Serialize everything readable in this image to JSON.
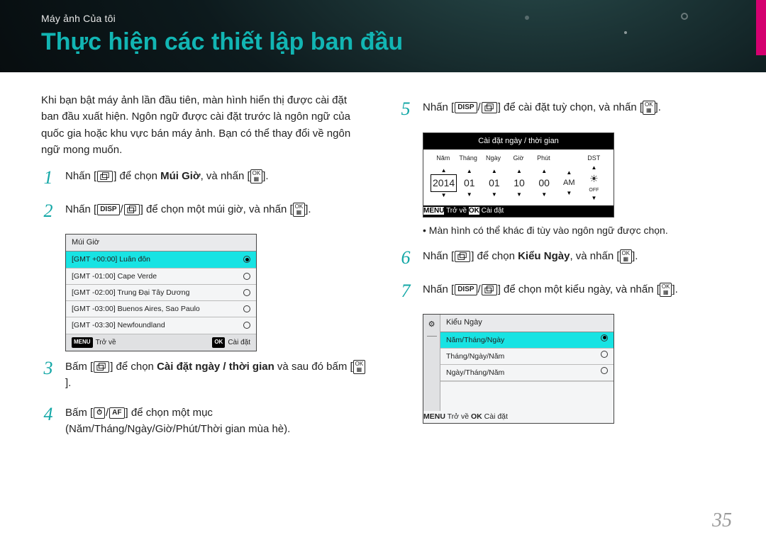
{
  "breadcrumb": "Máy ảnh Của tôi",
  "title": "Thực hiện các thiết lập ban đầu",
  "intro": "Khi bạn bật máy ảnh lần đầu tiên, màn hình hiển thị được cài đặt ban đầu xuất hiện. Ngôn ngữ được cài đặt trước là ngôn ngữ của quốc gia hoặc khu vực bán máy ảnh. Bạn có thể thay đổi về ngôn ngữ mong muốn.",
  "steps": {
    "s1_a": "Nhấn [",
    "s1_b": "] để chọn ",
    "s1_bold": "Múi Giờ",
    "s1_c": ", và nhấn [",
    "s1_d": "].",
    "s2_a": "Nhấn [",
    "s2_b": "] để chọn một múi giờ, và nhấn [",
    "s2_c": "].",
    "s3_a": "Bấm [",
    "s3_b": "] để chọn ",
    "s3_bold": "Cài đặt ngày / thời gian",
    "s3_c": " và sau đó bấm [",
    "s3_d": "].",
    "s4_a": "Bấm [",
    "s4_b": "] để chọn một mục (Năm/Tháng/Ngày/Giờ/Phút/Thời gian mùa hè).",
    "s5_a": "Nhấn [",
    "s5_b": "] để cài đặt tuỳ chọn, và nhấn [",
    "s5_c": "].",
    "s6_a": "Nhấn [",
    "s6_b": "] để chọn ",
    "s6_bold": "Kiểu Ngày",
    "s6_c": ", và nhấn [",
    "s6_d": "].",
    "s7_a": "Nhấn [",
    "s7_b": "] để chọn một kiểu ngày, và nhấn [",
    "s7_c": "]."
  },
  "key_disp": "DISP",
  "key_ok": "OK",
  "key_menu": "MENU",
  "key_af": "AF",
  "tz_panel": {
    "title": "Múi Giờ",
    "rows": [
      "[GMT +00:00] Luân đôn",
      "[GMT -01:00] Cape Verde",
      "[GMT -02:00] Trung Đại Tây Dương",
      "[GMT -03:00] Buenos Aires, Sao Paulo",
      "[GMT -03:30] Newfoundland"
    ],
    "back": "Trở về",
    "set": "Cài đặt"
  },
  "dt_panel": {
    "title": "Cài đặt ngày / thời gian",
    "labels": [
      "Năm",
      "Tháng",
      "Ngày",
      "Giờ",
      "Phút",
      "",
      "DST"
    ],
    "year": "2014",
    "month": "01",
    "day": "01",
    "hour": "10",
    "minute": "00",
    "ampm": "AM",
    "dst_off": "OFF",
    "back": "Trở về",
    "set": "Cài đặt"
  },
  "note": "Màn hình có thể khác đi tùy vào ngôn ngữ được chọn.",
  "type_panel": {
    "title": "Kiểu Ngày",
    "rows": [
      "Năm/Tháng/Ngày",
      "Tháng/Ngày/Năm",
      "Ngày/Tháng/Năm"
    ],
    "back": "Trở về",
    "set": "Cài đặt"
  },
  "page_number": "35"
}
